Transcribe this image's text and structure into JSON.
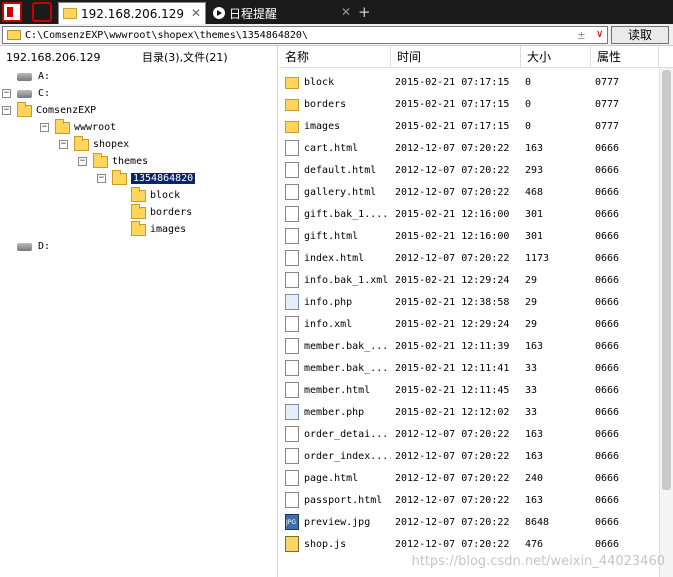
{
  "tabs": [
    {
      "label": "192.168.206.129"
    },
    {
      "label": "日程提醒"
    }
  ],
  "address": {
    "path": "C:\\ComsenzEXP\\wwwroot\\shopex\\themes\\1354864820\\",
    "read_button": "读取"
  },
  "left_panel": {
    "host": "192.168.206.129",
    "summary": "目录(3),文件(21)"
  },
  "tree": [
    {
      "label": "A:",
      "type": "drive"
    },
    {
      "label": "C:",
      "type": "drive",
      "expander": "-"
    },
    {
      "label": "ComsenzEXP",
      "type": "folder",
      "expander": "-"
    },
    {
      "label": "wwwroot",
      "type": "folder",
      "expander": "-"
    },
    {
      "label": "shopex",
      "type": "folder",
      "expander": "-"
    },
    {
      "label": "themes",
      "type": "folder",
      "expander": "-"
    },
    {
      "label": "1354864820",
      "type": "folder",
      "expander": "-",
      "selected": true
    },
    {
      "label": "block",
      "type": "folder"
    },
    {
      "label": "borders",
      "type": "folder"
    },
    {
      "label": "images",
      "type": "folder"
    },
    {
      "label": "D:",
      "type": "drive"
    }
  ],
  "columns": {
    "name": "名称",
    "time": "时间",
    "size": "大小",
    "attr": "属性"
  },
  "files": [
    {
      "name": "block",
      "time": "2015-02-21 07:17:15",
      "size": "0",
      "attr": "0777",
      "icon": "folder"
    },
    {
      "name": "borders",
      "time": "2015-02-21 07:17:15",
      "size": "0",
      "attr": "0777",
      "icon": "folder"
    },
    {
      "name": "images",
      "time": "2015-02-21 07:17:15",
      "size": "0",
      "attr": "0777",
      "icon": "folder"
    },
    {
      "name": "cart.html",
      "time": "2012-12-07 07:20:22",
      "size": "163",
      "attr": "0666",
      "icon": "file"
    },
    {
      "name": "default.html",
      "time": "2012-12-07 07:20:22",
      "size": "293",
      "attr": "0666",
      "icon": "file"
    },
    {
      "name": "gallery.html",
      "time": "2012-12-07 07:20:22",
      "size": "468",
      "attr": "0666",
      "icon": "file"
    },
    {
      "name": "gift.bak_1....",
      "time": "2015-02-21 12:16:00",
      "size": "301",
      "attr": "0666",
      "icon": "file"
    },
    {
      "name": "gift.html",
      "time": "2015-02-21 12:16:00",
      "size": "301",
      "attr": "0666",
      "icon": "file"
    },
    {
      "name": "index.html",
      "time": "2012-12-07 07:20:22",
      "size": "1173",
      "attr": "0666",
      "icon": "file"
    },
    {
      "name": "info.bak_1.xml",
      "time": "2015-02-21 12:29:24",
      "size": "29",
      "attr": "0666",
      "icon": "file"
    },
    {
      "name": "info.php",
      "time": "2015-02-21 12:38:58",
      "size": "29",
      "attr": "0666",
      "icon": "php"
    },
    {
      "name": "info.xml",
      "time": "2015-02-21 12:29:24",
      "size": "29",
      "attr": "0666",
      "icon": "file"
    },
    {
      "name": "member.bak_...",
      "time": "2015-02-21 12:11:39",
      "size": "163",
      "attr": "0666",
      "icon": "file"
    },
    {
      "name": "member.bak_...",
      "time": "2015-02-21 12:11:41",
      "size": "33",
      "attr": "0666",
      "icon": "file"
    },
    {
      "name": "member.html",
      "time": "2015-02-21 12:11:45",
      "size": "33",
      "attr": "0666",
      "icon": "file"
    },
    {
      "name": "member.php",
      "time": "2015-02-21 12:12:02",
      "size": "33",
      "attr": "0666",
      "icon": "php"
    },
    {
      "name": "order_detai...",
      "time": "2012-12-07 07:20:22",
      "size": "163",
      "attr": "0666",
      "icon": "file"
    },
    {
      "name": "order_index....",
      "time": "2012-12-07 07:20:22",
      "size": "163",
      "attr": "0666",
      "icon": "file"
    },
    {
      "name": "page.html",
      "time": "2012-12-07 07:20:22",
      "size": "240",
      "attr": "0666",
      "icon": "file"
    },
    {
      "name": "passport.html",
      "time": "2012-12-07 07:20:22",
      "size": "163",
      "attr": "0666",
      "icon": "file"
    },
    {
      "name": "preview.jpg",
      "time": "2012-12-07 07:20:22",
      "size": "8648",
      "attr": "0666",
      "icon": "jpg"
    },
    {
      "name": "shop.js",
      "time": "2012-12-07 07:20:22",
      "size": "476",
      "attr": "0666",
      "icon": "js"
    }
  ],
  "watermark": "https://blog.csdn.net/weixin_44023460"
}
